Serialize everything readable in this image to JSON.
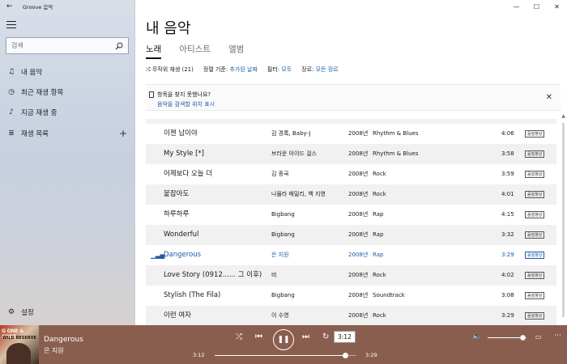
{
  "app": {
    "title": "Groove 음악"
  },
  "sidebar": {
    "search_placeholder": "검색",
    "items": [
      {
        "label": "내 음악"
      },
      {
        "label": "최근 재생 항목"
      },
      {
        "label": "지금 재생 중"
      },
      {
        "label": "재생 목록"
      }
    ],
    "settings_label": "설정"
  },
  "window": {
    "minimize": "—",
    "maximize": "☐",
    "close": "✕"
  },
  "main": {
    "title": "내 음악",
    "tabs": [
      {
        "label": "노래"
      },
      {
        "label": "아티스트"
      },
      {
        "label": "앨범"
      }
    ],
    "filters": {
      "shuffle": "무작위 재생 (21)",
      "sort_label": "정렬 기준:",
      "sort_value": "추가된 날짜",
      "filter_label": "필터:",
      "filter_value": "모두",
      "genre_label": "장르:",
      "genre_value": "모든 장르"
    },
    "notice": {
      "line1": "항목을 찾지 못했나요?",
      "line2": "음악을 검색할 위치 표시"
    },
    "songs": [
      {
        "title": "이젠 남이야",
        "artist": "김 경록, Baby-J",
        "year": "2008년",
        "genre": "Rhythm & Blues",
        "duration": "4:06",
        "badge": "음질향상"
      },
      {
        "title": "My Style [*]",
        "artist": "브라운 아이드 걸스",
        "year": "2008년",
        "genre": "Rhythm & Blues",
        "duration": "3:58",
        "badge": "음질향상"
      },
      {
        "title": "어제보다 오늘 더",
        "artist": "김 종국",
        "year": "2008년",
        "genre": "Rock",
        "duration": "3:59",
        "badge": "음질향상"
      },
      {
        "title": "붙잡아도",
        "artist": "나몰라 패밀리, 백 지영",
        "year": "2008년",
        "genre": "Rock",
        "duration": "4:01",
        "badge": "음질향상"
      },
      {
        "title": "하루하루",
        "artist": "Bigbang",
        "year": "2008년",
        "genre": "Rap",
        "duration": "4:15",
        "badge": "음질향상"
      },
      {
        "title": "Wonderful",
        "artist": "Bigbang",
        "year": "2008년",
        "genre": "Rap",
        "duration": "3:32",
        "badge": "음질향상"
      },
      {
        "title": "Dangerous",
        "artist": "은 지원",
        "year": "2008년",
        "genre": "Rap",
        "duration": "3:29",
        "badge": "음질향상"
      },
      {
        "title": "Love Story (0912...... 그 이후)",
        "artist": "비",
        "year": "2008년",
        "genre": "Rock",
        "duration": "4:02",
        "badge": "음질향상"
      },
      {
        "title": "Stylish (The Fila)",
        "artist": "Bigbang",
        "year": "2008년",
        "genre": "Soundtrack",
        "duration": "3:08",
        "badge": "음질향상"
      },
      {
        "title": "이런 여자",
        "artist": "이 수영",
        "year": "2008년",
        "genre": "Rock",
        "duration": "3:29",
        "badge": "음질향상"
      }
    ]
  },
  "player": {
    "album_art_text": "G ONE & CODE",
    "album_art_sub": "WILD RESERVE",
    "now_title": "Dangerous",
    "now_artist": "은 지원",
    "elapsed": "3:12",
    "total": "3:29",
    "tooltip": "3:12",
    "progress": 0.919,
    "volume": 0.9,
    "colors": {
      "bar": "#8a5e4e",
      "accent": "#1d5aa8"
    }
  }
}
